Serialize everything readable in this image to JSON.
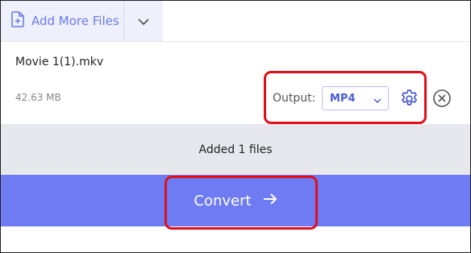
{
  "toolbar": {
    "add_files_label": "Add More Files",
    "add_files_icon": "file-add-icon",
    "dropdown_icon": "chevron-down-icon"
  },
  "file": {
    "name": "Movie 1(1).mkv",
    "size": "42.63 MB",
    "output_label": "Output:",
    "output_format": "MP4",
    "settings_icon": "gear-icon",
    "remove_icon": "close-circle-icon"
  },
  "status": {
    "text": "Added 1 files"
  },
  "convert": {
    "label": "Convert",
    "icon": "arrow-right-icon"
  },
  "colors": {
    "accent": "#6e7bf2",
    "highlight": "#e0101a",
    "status_bg": "#e7e8ed",
    "toolbar_bg": "#eef0fb"
  }
}
